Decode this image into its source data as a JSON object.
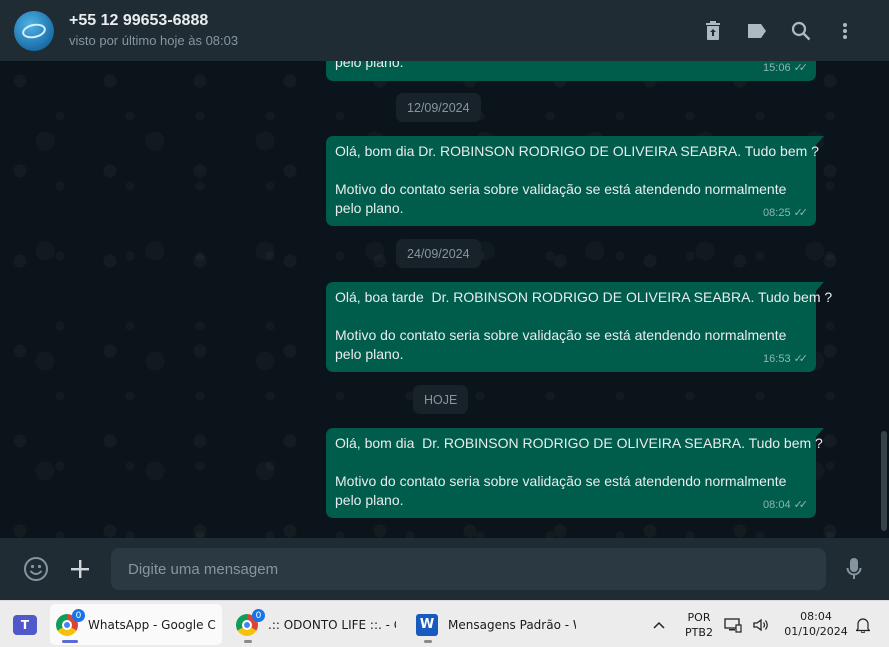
{
  "header": {
    "contact_name": "+55 12 99653-6888",
    "status": "visto por último hoje às 08:03",
    "actions": [
      "archive-icon",
      "label-icon",
      "search-icon",
      "more-vertical-icon"
    ]
  },
  "chat": {
    "top_fragment": {
      "text": "pelo plano.",
      "time": "15:06"
    },
    "groups": [
      {
        "date": "12/09/2024",
        "message": {
          "greeting": "Olá, bom dia Dr. ROBINSON RODRIGO DE OLIVEIRA SEABRA. Tudo bem ?",
          "body_line1": "Motivo do contato seria sobre validação se está atendendo normalmente",
          "body_line2": "pelo plano.",
          "time": "08:25"
        }
      },
      {
        "date": "24/09/2024",
        "message": {
          "greeting": "Olá, boa tarde  Dr. ROBINSON RODRIGO DE OLIVEIRA SEABRA. Tudo bem ?",
          "body_line1": "Motivo do contato seria sobre validação se está atendendo normalmente",
          "body_line2": "pelo plano.",
          "time": "16:53"
        }
      },
      {
        "date": "HOJE",
        "message": {
          "greeting": "Olá, bom dia  Dr. ROBINSON RODRIGO DE OLIVEIRA SEABRA. Tudo bem ?",
          "body_line1": "Motivo do contato seria sobre validação se está atendendo normalmente",
          "body_line2": "pelo plano.",
          "time": "08:04"
        }
      }
    ],
    "read_ticks": "✓✓"
  },
  "composer": {
    "placeholder": "Digite uma mensagem"
  },
  "taskbar": {
    "apps": [
      {
        "label": "WhatsApp - Google Chr",
        "badge": "0"
      },
      {
        "label": ".:: ODONTO LIFE ::. - Goo",
        "badge": "0"
      },
      {
        "label": "Mensagens Padrão - Wo"
      }
    ],
    "language": "POR",
    "keyboard": "PTB2",
    "time": "08:04",
    "date": "01/10/2024",
    "word_letter": "W",
    "teams_letter": "T"
  },
  "colors": {
    "outgoing_bubble": "#005c4b",
    "header_bg": "#202c33",
    "chat_bg": "#0b141a"
  }
}
